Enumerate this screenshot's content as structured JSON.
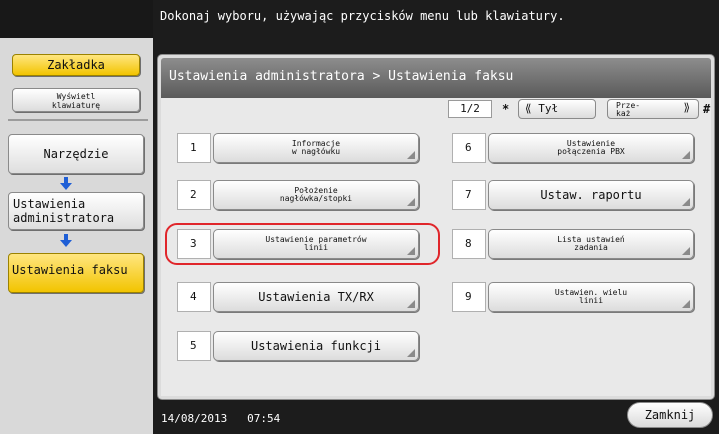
{
  "instruction": "Dokonaj wyboru, używając przycisków menu lub klawiatury.",
  "sidebar": {
    "tab_label": "Zakładka",
    "keyboard_line1": "Wyświetl",
    "keyboard_line2": "klawiaturę",
    "tool_label": "Narzędzie",
    "admin_line1": "Ustawienia",
    "admin_line2": "administratora",
    "fax_label": "Ustawienia faksu"
  },
  "panel": {
    "breadcrumb": "Ustawienia administratora  > Ustawienia faksu",
    "page_indicator": "1/2",
    "star_symbol": "*",
    "back_label": "Tył",
    "next_line1": "Prze-",
    "next_line2": "każ",
    "hash_symbol": "#"
  },
  "items": {
    "left": [
      {
        "num": "1",
        "line1": "Informacje",
        "line2": "w nagłówku"
      },
      {
        "num": "2",
        "line1": "Położenie",
        "line2": "nagłówka/stopki"
      },
      {
        "num": "3",
        "line1": "Ustawienie parametrów",
        "line2": "linii"
      },
      {
        "num": "4",
        "label": "Ustawienia TX/RX"
      },
      {
        "num": "5",
        "label": "Ustawienia funkcji"
      }
    ],
    "right": [
      {
        "num": "6",
        "line1": "Ustawienie",
        "line2": "połączenia PBX"
      },
      {
        "num": "7",
        "label": "Ustaw. raportu"
      },
      {
        "num": "8",
        "line1": "Lista ustawień",
        "line2": "zadania"
      },
      {
        "num": "9",
        "line1": "Ustawien. wielu",
        "line2": "linii"
      }
    ]
  },
  "footer": {
    "date": "14/08/2013",
    "time": "07:54",
    "close_label": "Zamknij"
  },
  "colors": {
    "accent_yellow": "#f2c400",
    "highlight_red": "#e0262b",
    "arrow_blue": "#1f5fd6"
  }
}
